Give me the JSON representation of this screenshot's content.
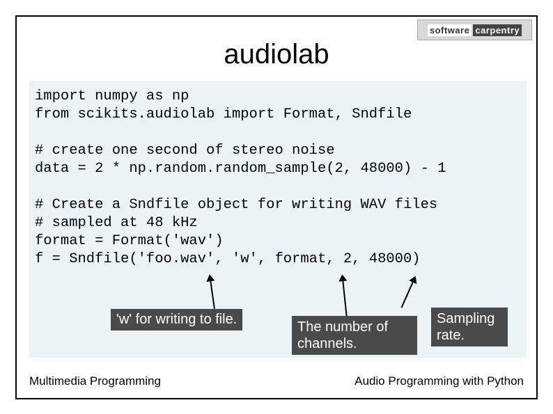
{
  "logo": {
    "left": "software",
    "right": "carpentry"
  },
  "title": "audiolab",
  "code": "import numpy as np\nfrom scikits.audiolab import Format, Sndfile\n\n# create one second of stereo noise\ndata = 2 * np.random.random_sample(2, 48000) - 1\n\n# Create a Sndfile object for writing WAV files\n# sampled at 48 kHz\nformat = Format('wav')\nf = Sndfile('foo.wav', 'w', format, 2, 48000)",
  "annotations": {
    "a1": "'w' for writing to file.",
    "a2": "The number of channels.",
    "a3": "Sampling rate."
  },
  "footer": {
    "left": "Multimedia Programming",
    "right": "Audio Programming with Python"
  }
}
